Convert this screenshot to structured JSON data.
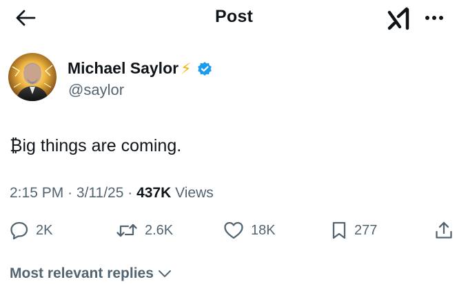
{
  "header": {
    "title": "Post",
    "icons": {
      "back": "arrow-left-icon",
      "grok": "grok-logo-icon",
      "more": "more-horizontal-icon"
    }
  },
  "author": {
    "name": "Michael Saylor",
    "name_emoji": "⚡",
    "verified": true,
    "handle": "@saylor",
    "verified_color": "#1d9bf0"
  },
  "tweet": {
    "text": "₿ig things are coming."
  },
  "meta": {
    "time": "2:15 PM",
    "separator": "·",
    "date": "3/11/25",
    "views_count": "437K",
    "views_label": "Views"
  },
  "actions": {
    "replies": "2K",
    "reposts": "2.6K",
    "likes": "18K",
    "bookmarks": "277",
    "icons": [
      "reply-icon",
      "retweet-icon",
      "heart-icon",
      "bookmark-icon",
      "share-icon"
    ]
  },
  "replies_sort": {
    "label": "Most relevant replies"
  },
  "colors": {
    "text_primary": "#0f1419",
    "text_secondary": "#536471",
    "accent": "#1d9bf0"
  }
}
